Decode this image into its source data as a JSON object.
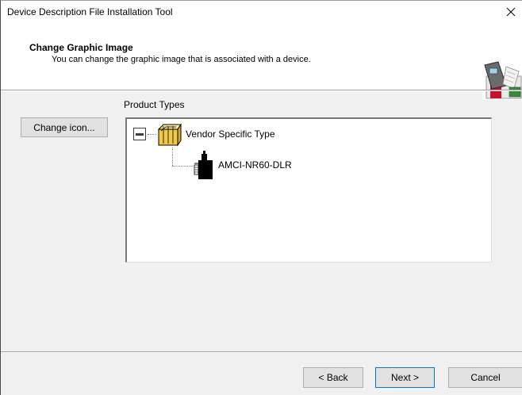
{
  "window": {
    "title": "Device Description File Installation Tool",
    "close_glyph": "✕"
  },
  "header": {
    "title": "Change Graphic Image",
    "subtitle": "You can change the graphic image that is associated with a device.",
    "icon": "wizard-graphic-icon"
  },
  "main": {
    "change_icon_label": "Change icon...",
    "group_label": "Product Types",
    "tree": {
      "root": {
        "label": "Vendor Specific Type",
        "expanded": true,
        "icon": "folder-icon",
        "children": [
          {
            "label": "AMCI-NR60-DLR",
            "icon": "device-icon"
          }
        ]
      }
    }
  },
  "footer": {
    "back_label": "< Back",
    "next_label": "Next >",
    "cancel_label": "Cancel"
  },
  "colors": {
    "dialog_bg": "#f0f0f0",
    "header_bg": "#ffffff",
    "button_bg": "#e1e1e1",
    "default_button_border": "#0078d7",
    "folder_yellow": "#f5d76e"
  }
}
